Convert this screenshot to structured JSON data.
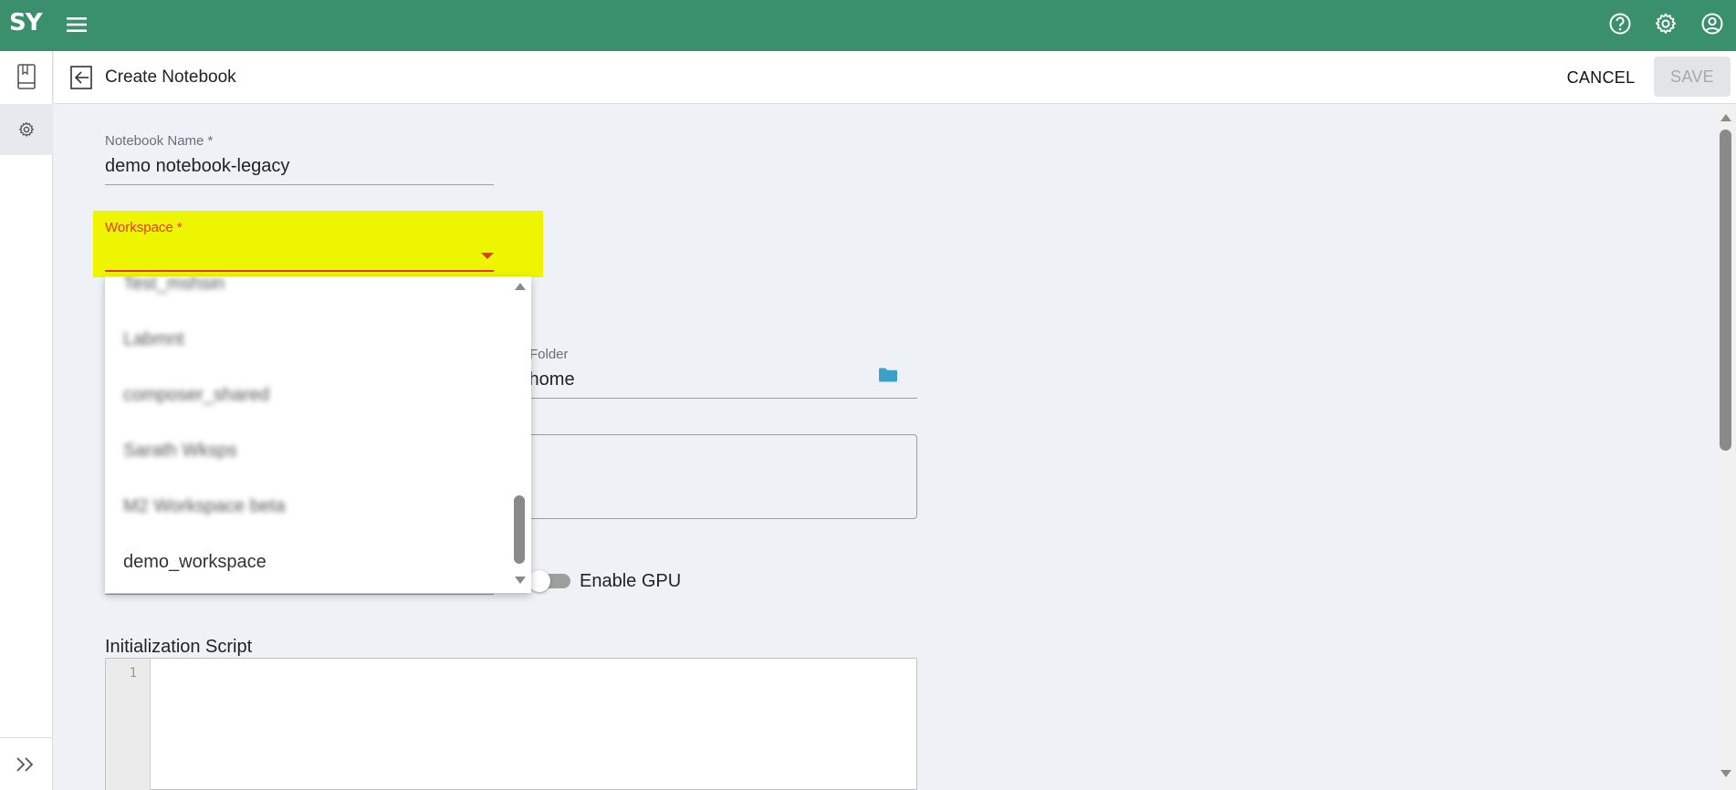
{
  "app": {
    "logo_text": "SY",
    "brand_color": "#3a8f6c"
  },
  "topbar": {
    "icons": [
      "menu-icon",
      "help-icon",
      "settings-gear-icon",
      "account-icon"
    ]
  },
  "rail": {
    "icons": [
      "notebook-icon",
      "gear-icon",
      "expand-chevrons-icon"
    ]
  },
  "header": {
    "title": "Create Notebook",
    "cancel_label": "CANCEL",
    "save_label": "SAVE"
  },
  "form": {
    "notebook_name": {
      "label": "Notebook Name *",
      "value": "demo notebook-legacy"
    },
    "workspace": {
      "label": "Workspace *",
      "value": "",
      "error_color": "#e53935",
      "highlight_color": "#eef500",
      "options": [
        {
          "label": "Test_mshsin",
          "blurred": true
        },
        {
          "label": "Labmnt",
          "blurred": true
        },
        {
          "label": "composer_shared",
          "blurred": true
        },
        {
          "label": "Sarath Wksps",
          "blurred": true
        },
        {
          "label": "M2 Workspace beta",
          "blurred": true
        },
        {
          "label": "demo_workspace",
          "blurred": false
        }
      ]
    },
    "folder": {
      "label": "Folder",
      "value": "/home"
    },
    "description": {
      "value": ""
    },
    "gpu": {
      "label": "Enable GPU",
      "enabled": false
    },
    "init_script": {
      "label": "Initialization Script",
      "line_numbers": [
        "1"
      ]
    }
  }
}
